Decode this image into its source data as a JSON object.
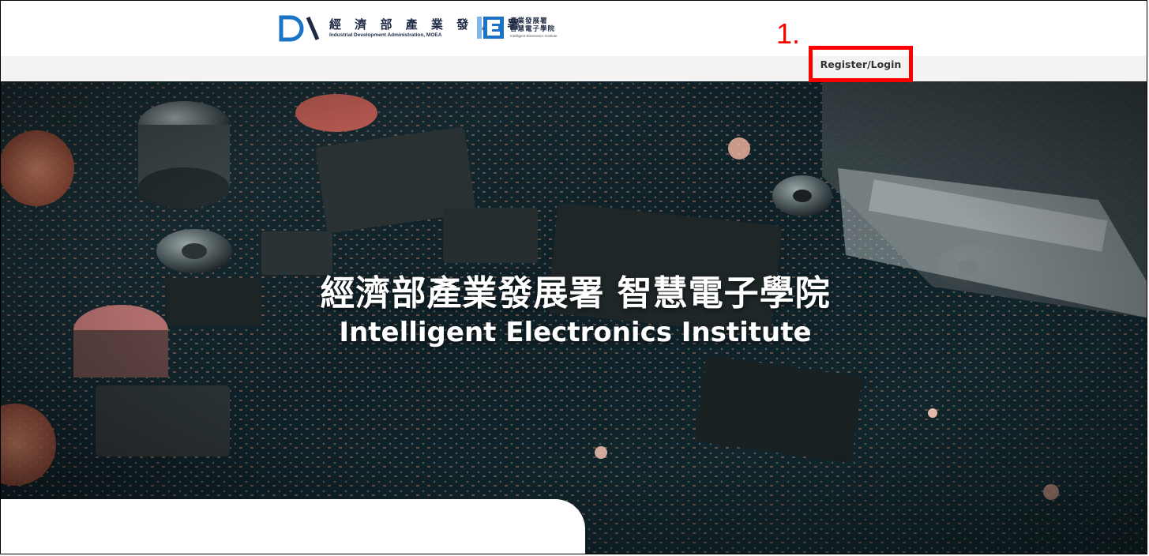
{
  "header": {
    "ida_logo": {
      "name_zh": "經 濟 部 產 業 發 展 署",
      "name_en": "Industrial Development Administration, MOEA"
    },
    "iei_logo": {
      "name_zh_line1": "產業發展署",
      "name_zh_line2": "智慧電子學院",
      "name_en": "Intelligent Electronics Institute"
    },
    "step_annotation": "1."
  },
  "nav": {
    "login_label": "Register/Login"
  },
  "hero": {
    "title_zh": "經濟部產業發展署 智慧電子學院",
    "title_en": "Intelligent Electronics Institute"
  },
  "colors": {
    "annotation_red": "#ff0000",
    "nav_strip": "#f3f3f1",
    "logo_blue": "#1a73c7",
    "logo_navy": "#1f2a44"
  }
}
